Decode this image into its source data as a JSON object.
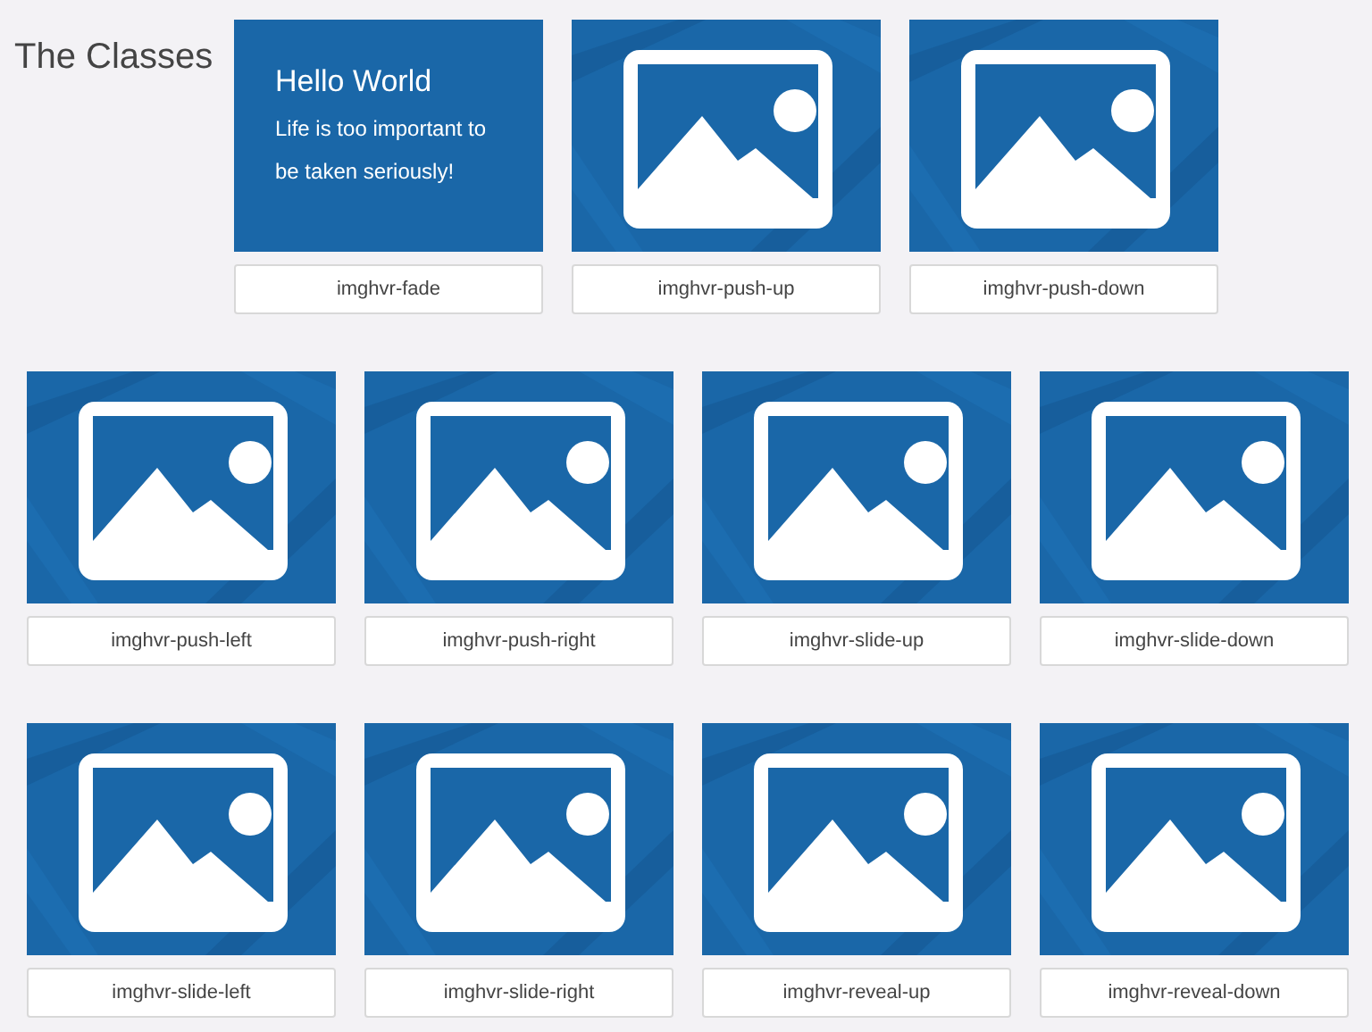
{
  "heading": "The Classes",
  "rows": [
    [
      {
        "kind": "hover",
        "title": "Hello World",
        "text": "Life is too important to be taken seriously!",
        "label": "imghvr-fade"
      },
      {
        "kind": "image",
        "label": "imghvr-push-up"
      },
      {
        "kind": "image",
        "label": "imghvr-push-down"
      }
    ],
    [
      {
        "kind": "image",
        "label": "imghvr-push-left"
      },
      {
        "kind": "image",
        "label": "imghvr-push-right"
      },
      {
        "kind": "image",
        "label": "imghvr-slide-up"
      },
      {
        "kind": "image",
        "label": "imghvr-slide-down"
      }
    ],
    [
      {
        "kind": "image",
        "label": "imghvr-slide-left"
      },
      {
        "kind": "image",
        "label": "imghvr-slide-right"
      },
      {
        "kind": "image",
        "label": "imghvr-reveal-up"
      },
      {
        "kind": "image",
        "label": "imghvr-reveal-down"
      }
    ]
  ]
}
